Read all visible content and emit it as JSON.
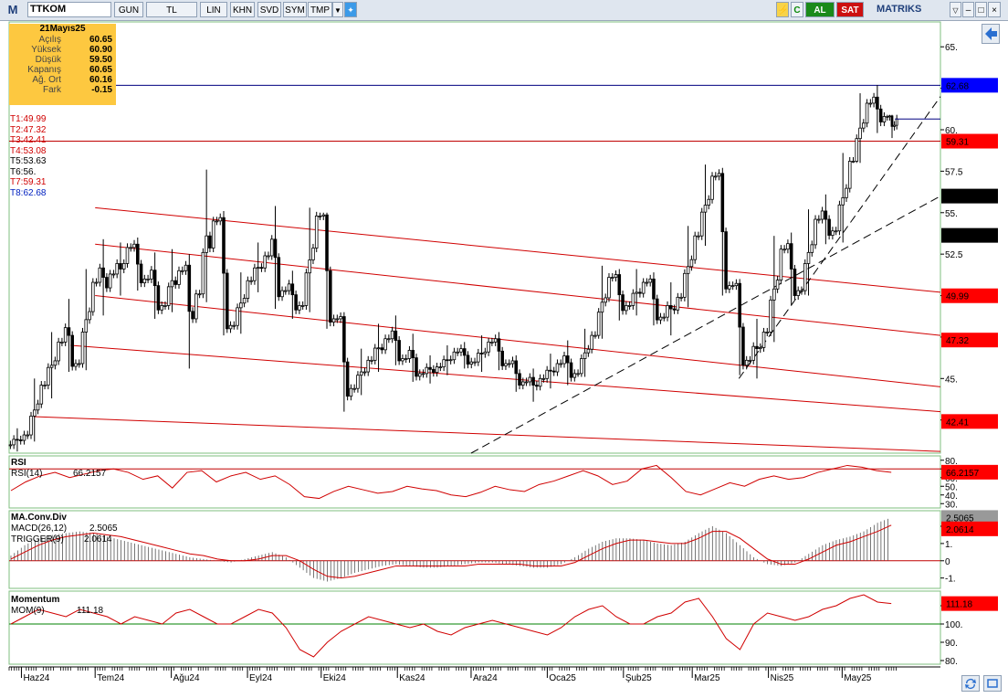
{
  "toolbar": {
    "logo": "M",
    "symbol": "TTKOM",
    "buttons": [
      "GUN",
      "TL",
      "LIN",
      "KHN",
      "SVD",
      "SYM",
      "TMP"
    ],
    "right_buttons": [
      "C",
      "AL",
      "SAT"
    ],
    "brand": "MATRIKS"
  },
  "info": {
    "date": "21Mayıs25",
    "rows": [
      {
        "label": "Açılış",
        "value": "60.65"
      },
      {
        "label": "Yüksek",
        "value": "60.90"
      },
      {
        "label": "Düşük",
        "value": "59.50"
      },
      {
        "label": "Kapanış",
        "value": "60.65"
      },
      {
        "label": "Ağ. Ort",
        "value": "60.16"
      },
      {
        "label": "Fark",
        "value": "-0.15"
      }
    ]
  },
  "levels": [
    {
      "label": "T1:49.99",
      "color": "#d00000"
    },
    {
      "label": "T2:47.32",
      "color": "#d00000"
    },
    {
      "label": "T3:42.41",
      "color": "#d00000"
    },
    {
      "label": "T4:53.08",
      "color": "#d00000"
    },
    {
      "label": "T5:53.63",
      "color": "#000000"
    },
    {
      "label": "T6:56.",
      "color": "#000000"
    },
    {
      "label": "T7:59.31",
      "color": "#d00000"
    },
    {
      "label": "T8:62.68",
      "color": "#0020c0"
    }
  ],
  "chart_data": [
    {
      "type": "candlestick",
      "title": "TTKOM",
      "y_ticks": [
        "65.",
        "62.5",
        "60.",
        "57.5",
        "55.",
        "52.5",
        "50.",
        "47.5",
        "45.",
        "42.5"
      ],
      "ylim": [
        40.5,
        66.5
      ],
      "x_ticks": [
        "Haz24",
        "Tem24",
        "Ağu24",
        "Eyl24",
        "Eki24",
        "Kas24",
        "Ara24",
        "Oca25",
        "Şub25",
        "Mar25",
        "Nis25",
        "May25"
      ],
      "markers": [
        {
          "label": "62.68",
          "value": 62.68,
          "bg": "#0000ff",
          "fg": "#ffffff"
        },
        {
          "label": "59.31",
          "value": 59.31,
          "bg": "#ff0000",
          "fg": "#ffffff"
        },
        {
          "label": "56.",
          "value": 56.0,
          "bg": "#000000",
          "fg": "#ffffff"
        },
        {
          "label": "53.63",
          "value": 53.63,
          "bg": "#000000",
          "fg": "#ffffff"
        },
        {
          "label": "49.99",
          "value": 49.99,
          "bg": "#ff0000",
          "fg": "#ffffff"
        },
        {
          "label": "47.32",
          "value": 47.32,
          "bg": "#ff0000",
          "fg": "#ffffff"
        },
        {
          "label": "42.41",
          "value": 42.41,
          "bg": "#ff0000",
          "fg": "#ffffff"
        }
      ],
      "horizontal_lines": [
        {
          "value": 62.68,
          "color": "#000080"
        },
        {
          "value": 59.31,
          "color": "#c00000"
        }
      ],
      "channel_lines": [
        {
          "from": [
            "2024-06-06",
            42.7
          ],
          "to": [
            "2025-06-10",
            40.6
          ]
        },
        {
          "from": [
            "2024-06-21",
            47.0
          ],
          "to": [
            "2025-06-10",
            43.0
          ]
        },
        {
          "from": [
            "2024-07-01",
            50.0
          ],
          "to": [
            "2025-06-10",
            44.5
          ]
        },
        {
          "from": [
            "2024-07-01",
            53.1
          ],
          "to": [
            "2025-06-10",
            47.6
          ]
        },
        {
          "from": [
            "2024-07-01",
            55.3
          ],
          "to": [
            "2025-06-10",
            50.2
          ]
        }
      ],
      "dashed_trendlines": [
        {
          "from": [
            "2024-12-01",
            40.5
          ],
          "to": [
            "2025-06-10",
            56.0
          ]
        },
        {
          "from": [
            "2025-03-20",
            45.0
          ],
          "to": [
            "2025-06-10",
            62.0
          ]
        }
      ],
      "last_close": {
        "date": "2025-05-21",
        "value": 60.65
      },
      "series": [
        {
          "date": "2024-05-27",
          "open": 41.0,
          "high": 42.0,
          "low": 40.6,
          "close": 41.6
        },
        {
          "date": "2024-06-03",
          "open": 41.6,
          "high": 45.0,
          "low": 41.2,
          "close": 44.6
        },
        {
          "date": "2024-06-10",
          "open": 44.6,
          "high": 47.8,
          "low": 43.8,
          "close": 47.2
        },
        {
          "date": "2024-06-17",
          "open": 47.2,
          "high": 49.8,
          "low": 45.4,
          "close": 45.9
        },
        {
          "date": "2024-06-24",
          "open": 45.9,
          "high": 51.6,
          "low": 45.5,
          "close": 50.8
        },
        {
          "date": "2024-07-01",
          "open": 50.8,
          "high": 53.4,
          "low": 48.8,
          "close": 51.3
        },
        {
          "date": "2024-07-08",
          "open": 51.3,
          "high": 53.2,
          "low": 50.0,
          "close": 52.9
        },
        {
          "date": "2024-07-15",
          "open": 52.9,
          "high": 53.5,
          "low": 50.3,
          "close": 51.0
        },
        {
          "date": "2024-07-22",
          "open": 51.0,
          "high": 52.6,
          "low": 48.6,
          "close": 49.4
        },
        {
          "date": "2024-07-29",
          "open": 49.4,
          "high": 52.8,
          "low": 49.0,
          "close": 51.5
        },
        {
          "date": "2024-08-05",
          "open": 51.5,
          "high": 52.5,
          "low": 45.6,
          "close": 50.1
        },
        {
          "date": "2024-08-12",
          "open": 50.1,
          "high": 57.6,
          "low": 49.6,
          "close": 54.5
        },
        {
          "date": "2024-08-19",
          "open": 54.5,
          "high": 55.1,
          "low": 47.6,
          "close": 48.2
        },
        {
          "date": "2024-08-26",
          "open": 48.2,
          "high": 51.4,
          "low": 47.7,
          "close": 50.9
        },
        {
          "date": "2024-09-02",
          "open": 50.9,
          "high": 53.2,
          "low": 50.2,
          "close": 52.4
        },
        {
          "date": "2024-09-09",
          "open": 52.4,
          "high": 55.4,
          "low": 49.2,
          "close": 50.3
        },
        {
          "date": "2024-09-16",
          "open": 50.3,
          "high": 51.5,
          "low": 48.6,
          "close": 49.4
        },
        {
          "date": "2024-09-23",
          "open": 49.4,
          "high": 55.3,
          "low": 49.0,
          "close": 54.8
        },
        {
          "date": "2024-09-30",
          "open": 54.8,
          "high": 55.0,
          "low": 48.0,
          "close": 48.6
        },
        {
          "date": "2024-10-07",
          "open": 48.6,
          "high": 49.0,
          "low": 43.0,
          "close": 44.4
        },
        {
          "date": "2024-10-14",
          "open": 44.4,
          "high": 46.8,
          "low": 44.0,
          "close": 46.1
        },
        {
          "date": "2024-10-21",
          "open": 46.1,
          "high": 48.3,
          "low": 45.4,
          "close": 47.4
        },
        {
          "date": "2024-10-28",
          "open": 47.4,
          "high": 48.8,
          "low": 45.8,
          "close": 46.2
        },
        {
          "date": "2024-11-04",
          "open": 46.2,
          "high": 47.7,
          "low": 44.8,
          "close": 45.3
        },
        {
          "date": "2024-11-11",
          "open": 45.3,
          "high": 46.4,
          "low": 44.7,
          "close": 45.7
        },
        {
          "date": "2024-11-18",
          "open": 45.7,
          "high": 47.0,
          "low": 45.2,
          "close": 46.6
        },
        {
          "date": "2024-11-25",
          "open": 46.6,
          "high": 47.2,
          "low": 45.6,
          "close": 46.0
        },
        {
          "date": "2024-12-02",
          "open": 46.0,
          "high": 47.6,
          "low": 45.4,
          "close": 47.2
        },
        {
          "date": "2024-12-09",
          "open": 47.2,
          "high": 47.8,
          "low": 45.5,
          "close": 45.9
        },
        {
          "date": "2024-12-16",
          "open": 45.9,
          "high": 46.4,
          "low": 44.2,
          "close": 44.8
        },
        {
          "date": "2024-12-23",
          "open": 44.8,
          "high": 45.6,
          "low": 43.6,
          "close": 45.0
        },
        {
          "date": "2024-12-30",
          "open": 45.0,
          "high": 46.5,
          "low": 44.4,
          "close": 45.9
        },
        {
          "date": "2025-01-06",
          "open": 45.9,
          "high": 47.3,
          "low": 44.6,
          "close": 45.3
        },
        {
          "date": "2025-01-13",
          "open": 45.3,
          "high": 48.0,
          "low": 45.1,
          "close": 47.6
        },
        {
          "date": "2025-01-20",
          "open": 47.6,
          "high": 51.8,
          "low": 47.4,
          "close": 51.1
        },
        {
          "date": "2025-01-27",
          "open": 51.1,
          "high": 51.6,
          "low": 48.5,
          "close": 49.4
        },
        {
          "date": "2025-02-03",
          "open": 49.4,
          "high": 51.6,
          "low": 48.8,
          "close": 50.8
        },
        {
          "date": "2025-02-10",
          "open": 50.8,
          "high": 51.4,
          "low": 48.2,
          "close": 48.7
        },
        {
          "date": "2025-02-17",
          "open": 48.7,
          "high": 50.8,
          "low": 47.6,
          "close": 49.9
        },
        {
          "date": "2025-02-24",
          "open": 49.9,
          "high": 54.2,
          "low": 49.3,
          "close": 53.6
        },
        {
          "date": "2025-03-03",
          "open": 53.6,
          "high": 57.9,
          "low": 53.0,
          "close": 57.2
        },
        {
          "date": "2025-03-10",
          "open": 57.2,
          "high": 57.7,
          "low": 50.0,
          "close": 50.6
        },
        {
          "date": "2025-03-17",
          "open": 50.6,
          "high": 51.0,
          "low": 45.2,
          "close": 46.1
        },
        {
          "date": "2025-03-24",
          "open": 46.1,
          "high": 48.6,
          "low": 45.0,
          "close": 47.8
        },
        {
          "date": "2025-03-31",
          "open": 47.8,
          "high": 53.6,
          "low": 47.2,
          "close": 52.8
        },
        {
          "date": "2025-04-07",
          "open": 52.8,
          "high": 53.8,
          "low": 49.4,
          "close": 50.3
        },
        {
          "date": "2025-04-14",
          "open": 50.3,
          "high": 55.2,
          "low": 50.0,
          "close": 54.6
        },
        {
          "date": "2025-04-21",
          "open": 54.6,
          "high": 56.1,
          "low": 53.1,
          "close": 53.9
        },
        {
          "date": "2025-04-28",
          "open": 53.9,
          "high": 58.6,
          "low": 53.2,
          "close": 58.1
        },
        {
          "date": "2025-05-05",
          "open": 58.1,
          "high": 62.2,
          "low": 58.0,
          "close": 61.6
        },
        {
          "date": "2025-05-12",
          "open": 61.6,
          "high": 62.7,
          "low": 59.8,
          "close": 60.8
        },
        {
          "date": "2025-05-19",
          "open": 60.8,
          "high": 60.9,
          "low": 59.5,
          "close": 60.65
        }
      ]
    },
    {
      "type": "line",
      "name": "RSI",
      "legend": [
        {
          "label": "RSI(14)",
          "value": "66.2157",
          "color": "#d00000"
        }
      ],
      "y_ticks": [
        "80.",
        "70.",
        "60.",
        "50.",
        "40.",
        "30."
      ],
      "ylim": [
        25,
        85
      ],
      "reference_line": {
        "value": 70,
        "color": "#c00000"
      },
      "marker": {
        "label": "66.2157",
        "value": 66.2157,
        "bg": "#ff0000"
      },
      "values": [
        45,
        55,
        62,
        66,
        60,
        64,
        68,
        70,
        66,
        58,
        62,
        48,
        66,
        68,
        55,
        62,
        66,
        58,
        62,
        52,
        38,
        36,
        44,
        50,
        46,
        42,
        44,
        50,
        47,
        45,
        40,
        38,
        43,
        50,
        46,
        44,
        52,
        56,
        62,
        68,
        62,
        52,
        56,
        70,
        74,
        60,
        44,
        40,
        47,
        54,
        50,
        58,
        62,
        58,
        60,
        66,
        70,
        74,
        72,
        68,
        66
      ]
    },
    {
      "type": "bar+line",
      "name": "MA.Conv.Div",
      "legend": [
        {
          "label": "MACD(26,12)",
          "value": "2.5065",
          "color": "#555555"
        },
        {
          "label": "TRIGGER(9)",
          "value": "2.0614",
          "color": "#d00000"
        }
      ],
      "y_ticks": [
        "2.",
        "1.",
        "0",
        "-1."
      ],
      "ylim": [
        -1.6,
        2.9
      ],
      "markers": [
        {
          "label": "2.5065",
          "value": 2.5065,
          "bg": "#999999"
        },
        {
          "label": "2.0614",
          "value": 2.0614,
          "bg": "#ff0000"
        }
      ],
      "macd": [
        0.3,
        0.9,
        1.3,
        1.5,
        1.6,
        1.7,
        1.6,
        1.4,
        1.2,
        1.0,
        0.8,
        0.6,
        0.4,
        0.2,
        0.1,
        0.0,
        -0.1,
        0.1,
        0.3,
        0.5,
        0.2,
        -0.4,
        -1.0,
        -1.2,
        -1.0,
        -0.7,
        -0.5,
        -0.3,
        -0.2,
        -0.3,
        -0.4,
        -0.4,
        -0.3,
        -0.2,
        -0.1,
        -0.1,
        -0.2,
        -0.3,
        -0.4,
        -0.4,
        -0.2,
        0.2,
        0.7,
        1.1,
        1.3,
        1.3,
        1.2,
        1.0,
        0.9,
        1.1,
        1.6,
        2.0,
        1.6,
        0.9,
        0.2,
        -0.2,
        -0.3,
        -0.1,
        0.4,
        0.9,
        1.2,
        1.4,
        1.7,
        2.2,
        2.5065
      ],
      "trigger": [
        0.1,
        0.5,
        0.9,
        1.2,
        1.4,
        1.5,
        1.6,
        1.5,
        1.4,
        1.2,
        1.0,
        0.8,
        0.6,
        0.4,
        0.3,
        0.1,
        0.0,
        0.0,
        0.1,
        0.3,
        0.3,
        0.0,
        -0.5,
        -0.9,
        -1.0,
        -0.9,
        -0.7,
        -0.5,
        -0.3,
        -0.3,
        -0.3,
        -0.3,
        -0.3,
        -0.3,
        -0.2,
        -0.2,
        -0.2,
        -0.2,
        -0.3,
        -0.3,
        -0.3,
        -0.1,
        0.3,
        0.7,
        1.0,
        1.2,
        1.2,
        1.1,
        1.0,
        1.0,
        1.3,
        1.7,
        1.7,
        1.3,
        0.7,
        0.1,
        -0.2,
        -0.2,
        0.1,
        0.5,
        0.9,
        1.1,
        1.4,
        1.7,
        2.0614
      ]
    },
    {
      "type": "line",
      "name": "Momentum",
      "legend": [
        {
          "label": "MOM(9)",
          "value": "111.18",
          "color": "#d00000"
        }
      ],
      "y_ticks": [
        "110.",
        "100.",
        "90.",
        "80."
      ],
      "ylim": [
        78,
        118
      ],
      "reference_line": {
        "value": 100,
        "color": "#008000"
      },
      "marker": {
        "label": "111.18",
        "value": 111.18,
        "bg": "#ff0000"
      },
      "values": [
        100,
        104,
        108,
        106,
        104,
        108,
        106,
        104,
        100,
        104,
        102,
        100,
        106,
        108,
        104,
        100,
        100,
        104,
        108,
        106,
        98,
        86,
        82,
        90,
        96,
        100,
        104,
        102,
        100,
        98,
        100,
        96,
        94,
        98,
        100,
        102,
        100,
        98,
        96,
        94,
        98,
        104,
        108,
        110,
        104,
        100,
        100,
        104,
        106,
        112,
        114,
        104,
        92,
        86,
        100,
        106,
        104,
        102,
        104,
        108,
        110,
        114,
        116,
        112,
        111.18
      ]
    }
  ]
}
